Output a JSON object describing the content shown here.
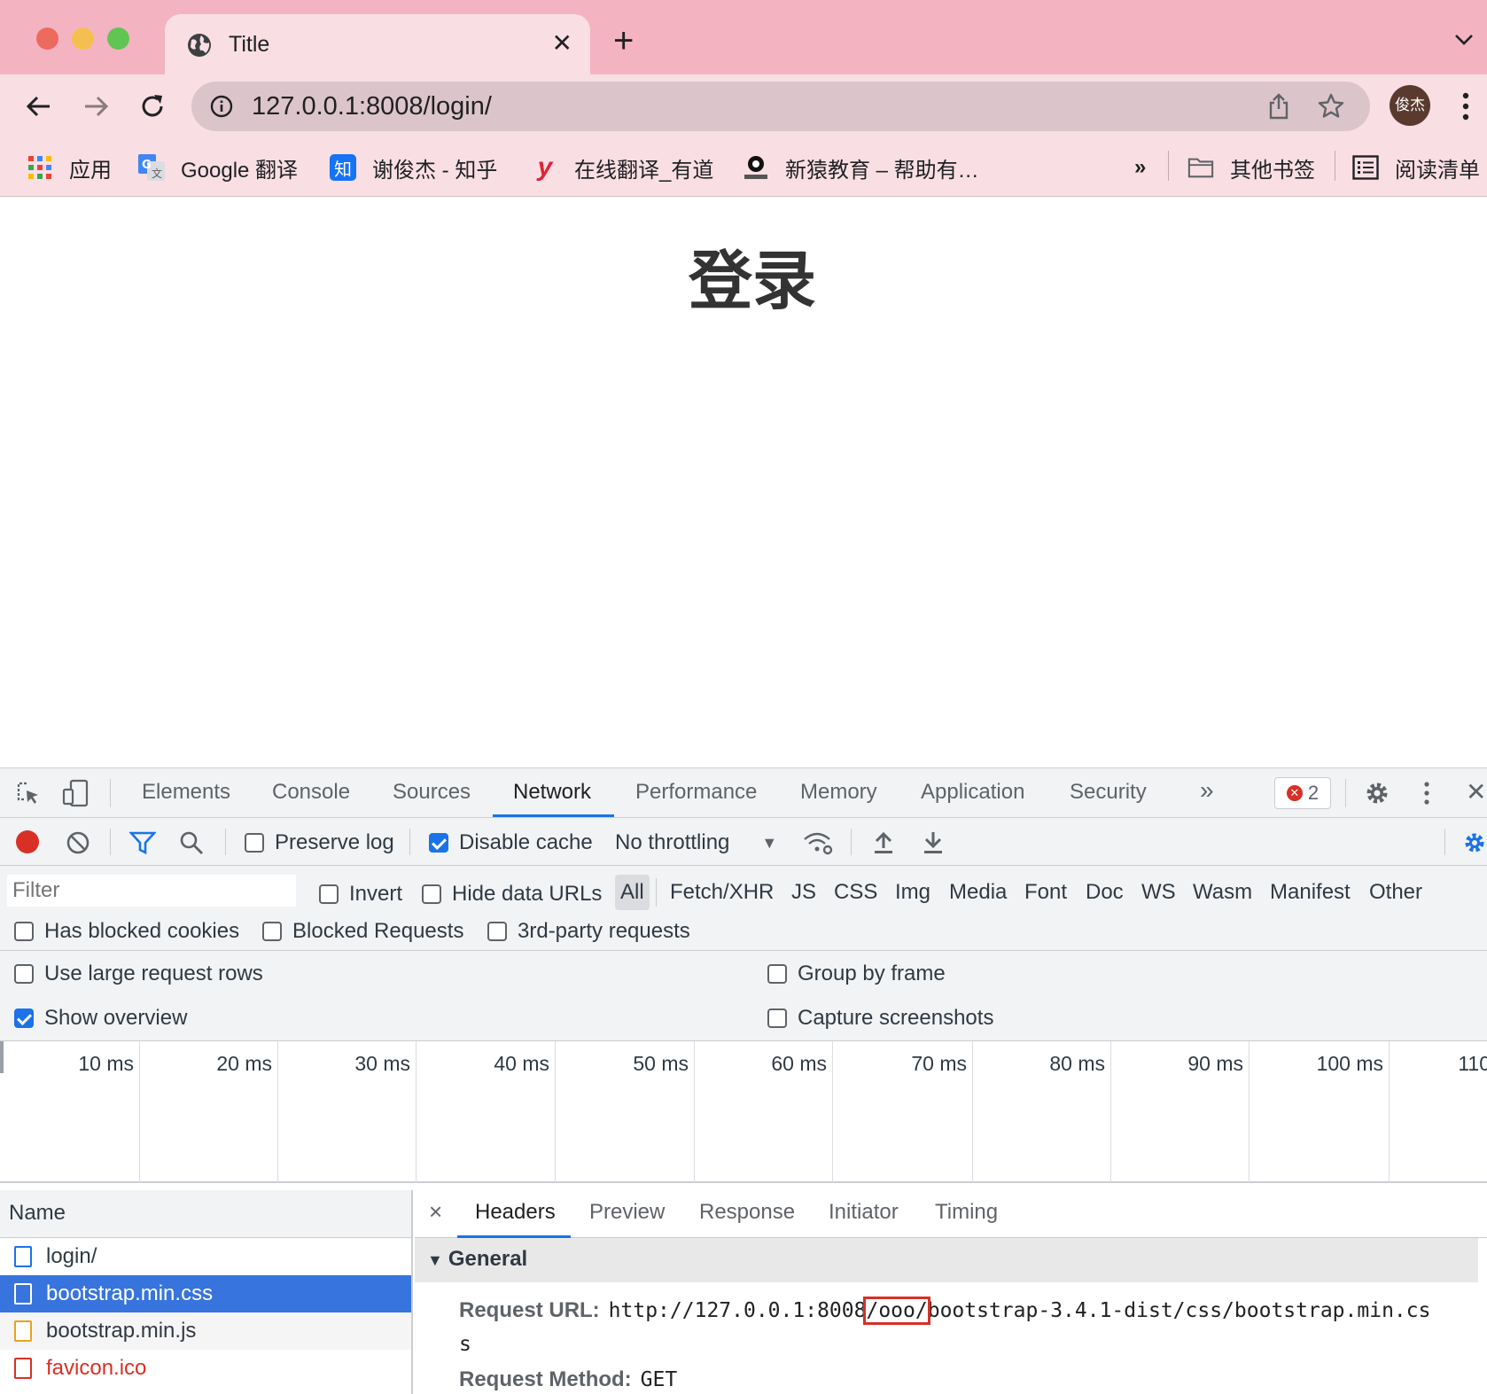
{
  "browser": {
    "tab_title": "Title",
    "url": "127.0.0.1:8008/login/",
    "avatar_text": "俊杰",
    "bookmarks": [
      {
        "label": "应用",
        "icon": "apps-grid-icon"
      },
      {
        "label": "Google 翻译",
        "icon": "google-translate-icon"
      },
      {
        "label": "谢俊杰 - 知乎",
        "icon": "zhihu-icon"
      },
      {
        "label": "在线翻译_有道",
        "icon": "youdao-icon"
      },
      {
        "label": "新猿教育 – 帮助有…",
        "icon": "xinyuan-icon"
      }
    ],
    "overflow_label": "»",
    "other_bookmarks": "其他书签",
    "reading_list": "阅读清单"
  },
  "page": {
    "heading": "登录"
  },
  "devtools": {
    "tabs": [
      "Elements",
      "Console",
      "Sources",
      "Network",
      "Performance",
      "Memory",
      "Application",
      "Security"
    ],
    "active_tab": "Network",
    "more_tabs": "»",
    "error_count": "2",
    "toolbar": {
      "preserve_log": "Preserve log",
      "disable_cache": "Disable cache",
      "throttling": "No throttling"
    },
    "filter": {
      "placeholder": "Filter",
      "invert": "Invert",
      "hide_data_urls": "Hide data URLs",
      "types": [
        "All",
        "Fetch/XHR",
        "JS",
        "CSS",
        "Img",
        "Media",
        "Font",
        "Doc",
        "WS",
        "Wasm",
        "Manifest",
        "Other"
      ],
      "has_blocked_cookies": "Has blocked cookies",
      "blocked_requests": "Blocked Requests",
      "third_party": "3rd-party requests"
    },
    "settings": {
      "large_rows": "Use large request rows",
      "group_by_frame": "Group by frame",
      "show_overview": "Show overview",
      "capture_screenshots": "Capture screenshots"
    },
    "overview_ticks": [
      "10 ms",
      "20 ms",
      "30 ms",
      "40 ms",
      "50 ms",
      "60 ms",
      "70 ms",
      "80 ms",
      "90 ms",
      "100 ms",
      "110"
    ],
    "requests": {
      "header": "Name",
      "items": [
        "login/",
        "bootstrap.min.css",
        "bootstrap.min.js",
        "favicon.ico"
      ],
      "selected": "bootstrap.min.css"
    },
    "detail": {
      "close": "×",
      "tabs": [
        "Headers",
        "Preview",
        "Response",
        "Initiator",
        "Timing"
      ],
      "active_tab": "Headers",
      "section": "General",
      "request_url_label": "Request URL:",
      "request_url_prefix": "http://127.0.0.1:8008",
      "request_url_highlight": "/ooo/",
      "request_url_suffix": "bootstrap-3.4.1-dist/css/bootstrap.min.cs",
      "request_url_wrap": "s",
      "request_method_label": "Request Method:",
      "request_method": "GET"
    }
  }
}
